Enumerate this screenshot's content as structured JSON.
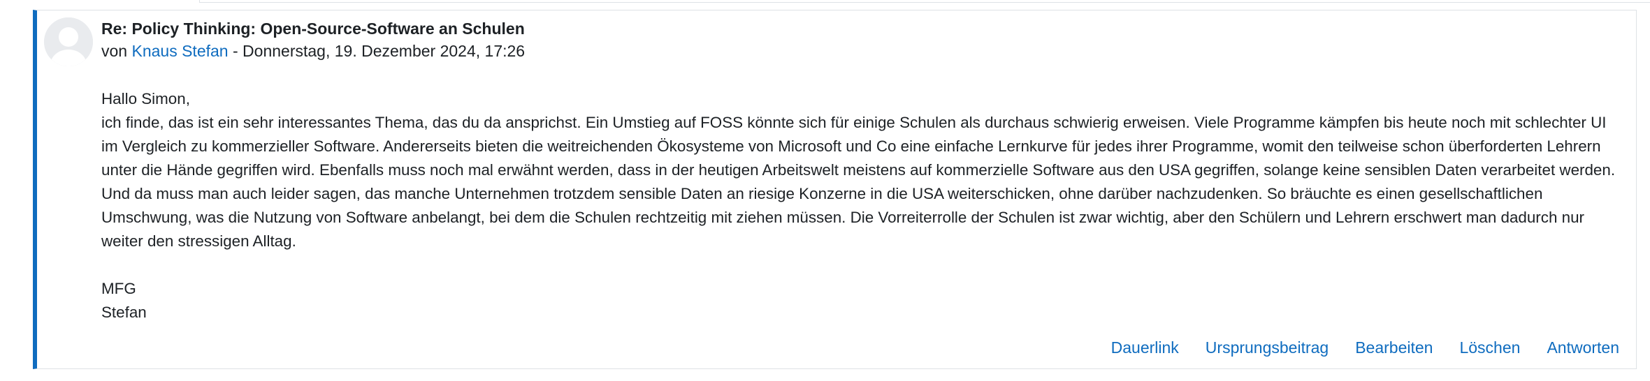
{
  "post": {
    "subject": "Re: Policy Thinking: Open-Source-Software an Schulen",
    "byline_prefix": "von ",
    "author": "Knaus Stefan",
    "byline_separator": " - ",
    "date": "Donnerstag, 19. Dezember 2024, 17:26",
    "greeting": "Hallo Simon,",
    "body": "ich finde, das ist ein sehr interessantes Thema, das du da ansprichst. Ein Umstieg auf FOSS könnte sich für einige Schulen als durchaus schwierig erweisen. Viele Programme kämpfen bis heute noch mit schlechter UI im Vergleich zu kommerzieller Software. Andererseits bieten die weitreichenden Ökosysteme von Microsoft und Co eine einfache Lernkurve für jedes ihrer Programme, womit den teilweise schon überforderten Lehrern unter die Hände gegriffen wird. Ebenfalls muss noch mal erwähnt werden, dass in der heutigen Arbeitswelt meistens auf kommerzielle Software aus den USA gegriffen, solange keine sensiblen Daten verarbeitet werden. Und da muss man auch leider sagen, das manche Unternehmen trotzdem sensible Daten an riesige Konzerne in die USA weiterschicken, ohne darüber nachzudenken. So bräuchte es einen gesellschaftlichen Umschwung, was die Nutzung von Software anbelangt, bei dem die Schulen rechtzeitig mit ziehen müssen. Die Vorreiterrolle der Schulen ist zwar wichtig, aber den Schülern und Lehrern erschwert man dadurch nur weiter den stressigen Alltag.",
    "signoff": "MFG",
    "signature": "Stefan"
  },
  "actions": {
    "permalink": "Dauerlink",
    "parent": "Ursprungsbeitrag",
    "edit": "Bearbeiten",
    "delete": "Löschen",
    "reply": "Antworten"
  },
  "colors": {
    "accent": "#0f6cbf",
    "border": "#dee2e6",
    "avatar_bg": "#e9ebee"
  }
}
